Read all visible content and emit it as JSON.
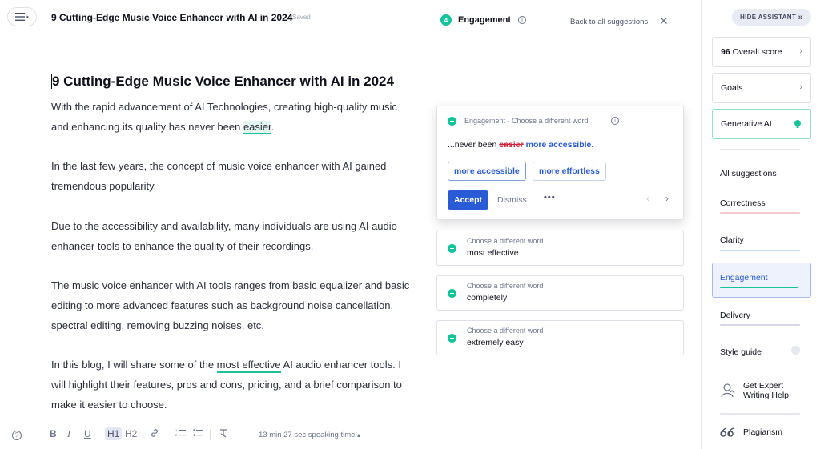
{
  "document": {
    "title": "9 Cutting-Edge Music Voice Enhancer with AI in 2024",
    "save_status": "Saved",
    "heading": "9 Cutting-Edge Music Voice Enhancer with AI in 2024",
    "p1_a": "With the rapid advancement of AI Technologies, creating high-quality music and enhancing its quality has never been ",
    "p1_flag": "easier",
    "p1_b": ".",
    "p2": "In the last few years, the concept of music voice enhancer with AI gained tremendous popularity.",
    "p3": "Due to the accessibility and availability, many individuals are using AI audio enhancer tools to enhance the quality of their recordings.",
    "p4": "The music voice enhancer with AI tools ranges from basic equalizer and basic editing to more advanced features such as background noise cancellation, spectral editing, removing buzzing noises, etc.",
    "p5_a": "In this blog, I will share some of the ",
    "p5_flag": "most effective",
    "p5_b": " AI audio enhancer tools. I will highlight their features, pros and cons, pricing, and a brief comparison to make it easier to choose."
  },
  "toolbar": {
    "help": "?",
    "bold": "B",
    "italic": "I",
    "underline": "U",
    "h1": "H1",
    "h2": "H2",
    "speaking_time": "13 min 27 sec speaking time",
    "speaking_caret": "▴"
  },
  "suggestions": {
    "count": "4",
    "category": "Engagement",
    "back_label": "Back to all suggestions",
    "active": {
      "label": "Engagement · Choose a different word",
      "prefix": "...never been",
      "original": "easier",
      "replacement": "more accessible.",
      "options": [
        "more accessible",
        "more effortless"
      ],
      "accept": "Accept",
      "dismiss": "Dismiss",
      "more": "•••"
    },
    "collapsed": [
      {
        "sub": "Choose a different word",
        "main": "most effective"
      },
      {
        "sub": "Choose a different word",
        "main": "completely"
      },
      {
        "sub": "Choose a different word",
        "main": "extremely easy"
      }
    ]
  },
  "sidebar": {
    "hide_label": "HIDE ASSISTANT",
    "hide_icon": "»",
    "score_value": "96",
    "score_label": "Overall score",
    "goals": "Goals",
    "generative_ai": "Generative AI",
    "all_suggestions": "All suggestions",
    "categories": [
      {
        "label": "Correctness",
        "color": "#f2c8cd"
      },
      {
        "label": "Clarity",
        "color": "#c9d6f3"
      },
      {
        "label": "Engagement",
        "color": "#15c39a"
      },
      {
        "label": "Delivery",
        "color": "#d9d3f0"
      },
      {
        "label": "Style guide",
        "color": "#e6e8ee"
      }
    ],
    "expert_help": "Get Expert Writing Help",
    "plagiarism": "Plagiarism"
  },
  "colors": {
    "accent_blue": "#2a5bd7",
    "accent_green": "#15c39a",
    "strike_red": "#d3213e"
  }
}
